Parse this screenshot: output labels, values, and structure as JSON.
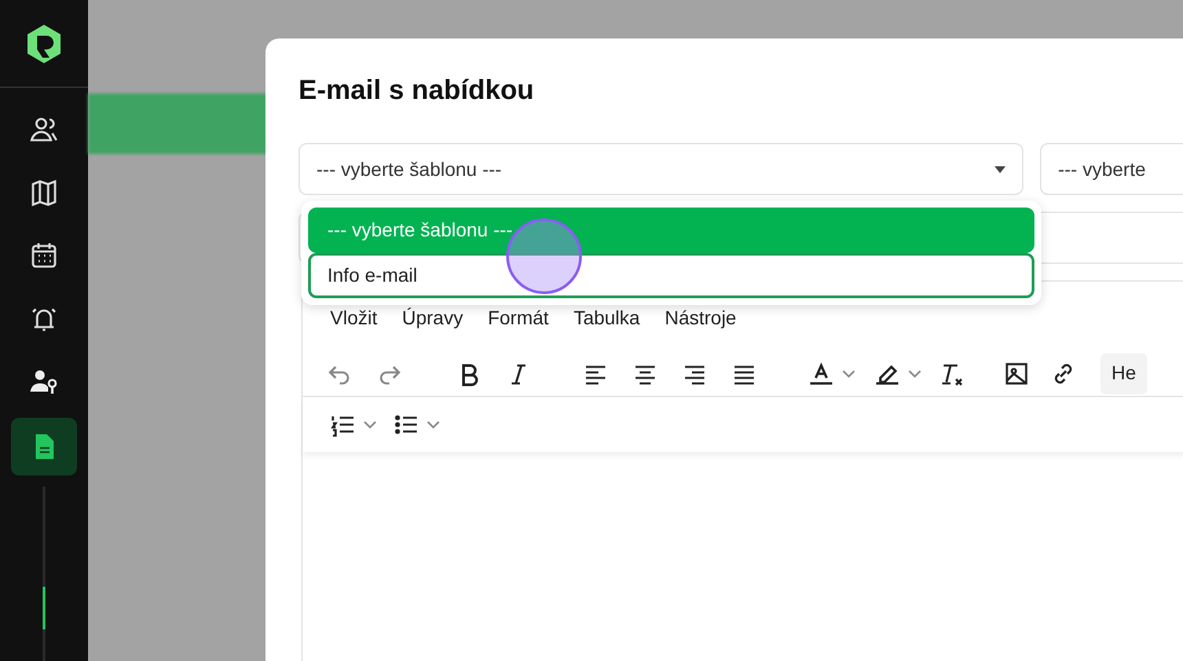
{
  "sidebar": {
    "items": [
      {
        "kind": "users",
        "selected": false
      },
      {
        "kind": "map",
        "selected": false
      },
      {
        "kind": "calendar",
        "selected": false
      },
      {
        "kind": "bell",
        "selected": false
      },
      {
        "kind": "userkey",
        "selected": false
      },
      {
        "kind": "document",
        "selected": true
      }
    ]
  },
  "modal": {
    "title": "E-mail s nabídkou",
    "template_select": {
      "value": "--- vyberte šablonu ---",
      "expanded": true,
      "options": [
        {
          "label": "--- vyberte šablonu ---",
          "selected": true,
          "highlighted": false
        },
        {
          "label": "Info e-mail",
          "selected": false,
          "highlighted": true
        }
      ]
    },
    "second_select": {
      "value": "--- vyberte"
    },
    "editor": {
      "menu": [
        "Vložit",
        "Úpravy",
        "Formát",
        "Tabulka",
        "Nástroje"
      ],
      "block_format": "He"
    }
  }
}
